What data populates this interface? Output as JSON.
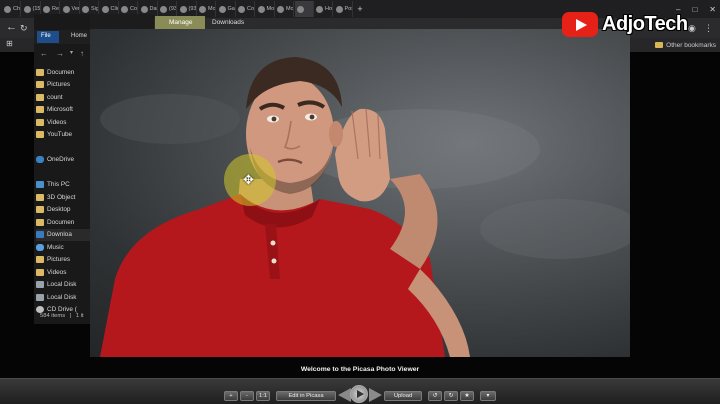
{
  "browser": {
    "tabs": [
      "Chr",
      "(15",
      "Res",
      "Ver",
      "Sig",
      "Clic",
      "Cor",
      "Dai",
      "(93",
      "(93",
      "Mo",
      "Gar",
      "Cor",
      "Mo",
      "Mo",
      "",
      "Ho",
      "Pos"
    ],
    "active_tab_index": 15,
    "new_tab": "+",
    "other_bookmarks": "Other bookmarks"
  },
  "explorer": {
    "ribbon_tabs": {
      "file": "File",
      "home": "Home"
    },
    "manage": "Manage",
    "downloads_title": "Downloads",
    "nav_items": [
      {
        "label": "Documen",
        "icon": "folder-icon"
      },
      {
        "label": "Pictures",
        "icon": "folder-icon"
      },
      {
        "label": "count",
        "icon": "folder-icon"
      },
      {
        "label": "Microsoft",
        "icon": "folder-icon"
      },
      {
        "label": "Videos",
        "icon": "folder-icon"
      },
      {
        "label": "YouTube",
        "icon": "folder-icon"
      },
      {
        "label": "",
        "icon": ""
      },
      {
        "label": "OneDrive",
        "icon": "cloud-icon"
      },
      {
        "label": "",
        "icon": ""
      },
      {
        "label": "This PC",
        "icon": "computer-icon"
      },
      {
        "label": "3D Object",
        "icon": "folder-icon"
      },
      {
        "label": "Desktop",
        "icon": "folder-icon"
      },
      {
        "label": "Documen",
        "icon": "folder-icon"
      },
      {
        "label": "Downloa",
        "icon": "download-icon"
      },
      {
        "label": "Music",
        "icon": "music-icon"
      },
      {
        "label": "Pictures",
        "icon": "folder-icon"
      },
      {
        "label": "Videos",
        "icon": "folder-icon"
      },
      {
        "label": "Local Disk",
        "icon": "disk-icon"
      },
      {
        "label": "Local Disk",
        "icon": "disk-icon"
      },
      {
        "label": "CD Drive (",
        "icon": "cd-icon"
      }
    ],
    "status": {
      "items": "584 items",
      "selected": "1 it"
    }
  },
  "watermark": {
    "brand": "AdjoTech"
  },
  "viewer": {
    "caption": "Welcome to the Picasa Photo Viewer",
    "buttons": {
      "zoom_in": "+",
      "zoom_out": "-",
      "actual_size": "1:1",
      "edit": "Edit in Picasa",
      "upload": "Upload"
    }
  },
  "colors": {
    "manage_tab": "#8a8c57",
    "shirt": "#b5181c",
    "cursor_highlight": "#d2c828",
    "youtube_red": "#e62117"
  }
}
